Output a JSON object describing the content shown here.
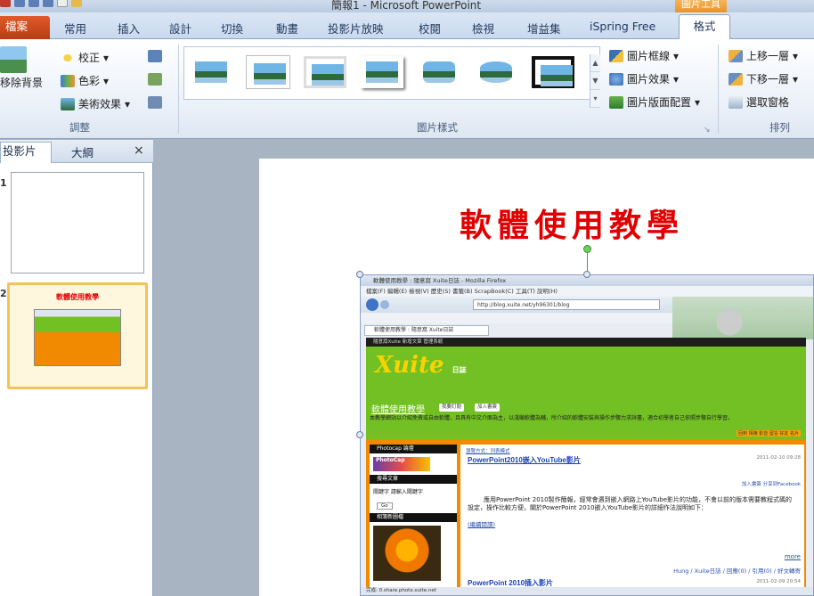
{
  "window": {
    "title": "簡報1 - Microsoft PowerPoint",
    "context_tab_group": "圖片工具"
  },
  "tabs": [
    {
      "label": "檔案"
    },
    {
      "label": "常用"
    },
    {
      "label": "插入"
    },
    {
      "label": "設計"
    },
    {
      "label": "切換"
    },
    {
      "label": "動畫"
    },
    {
      "label": "投影片放映"
    },
    {
      "label": "校閱"
    },
    {
      "label": "檢視"
    },
    {
      "label": "增益集"
    },
    {
      "label": "iSpring Free"
    },
    {
      "label": "格式"
    }
  ],
  "ribbon": {
    "adjust": {
      "remove_bg": "移除背景",
      "corrections": "校正",
      "color": "色彩",
      "artistic": "美術效果",
      "group_label": "調整"
    },
    "styles": {
      "border": "圖片框線",
      "effects": "圖片效果",
      "layout": "圖片版面配置",
      "group_label": "圖片樣式"
    },
    "arrange": {
      "bring_forward": "上移一層",
      "send_backward": "下移一層",
      "selection_pane": "選取窗格",
      "group_label": "排列"
    }
  },
  "slides_pane": {
    "tab_slides": "投影片",
    "tab_outline": "大綱",
    "close": "×",
    "slide1_num": "1",
    "slide2_num": "2",
    "slide2_thumb_title": "軟體使用教學"
  },
  "slide": {
    "title": "軟體使用教學"
  },
  "embedded_browser": {
    "window_title": "軟體使用教學 : 隨意窩 Xuite日誌 - Mozilla Firefox",
    "menu": "檔案(F)  編輯(E)  檢視(V)  歷史(S)  書籤(B)  ScrapBook(C)  工具(T)  說明(H)",
    "url": "http://blog.xuite.net/yh96301/blog",
    "tab": "軟體使用教學 : 隨意窩 Xuite日誌",
    "xuite_bar": "隨意窩Xuite  新增文章  管理系統",
    "logo": "Xuite",
    "logo_sub": "日誌",
    "blog_title": "軟體使用教學",
    "btn_subscribe": "我要訂閱",
    "btn_bookmark": "加入書簽",
    "description": "本教學網站以介紹免費或自由軟體，且具有中文介面為主，以淺顯軟體為輔，所介紹的軟體安裝與操作步驟力求詳盡，適合初學者自己依照步驟自行學習。",
    "nav_links": "回到  相簿  影音  留言  好友  名片",
    "side_photocap": "Photocap 論壇",
    "side_search": "搜尋文章",
    "side_search_hint": "關鍵字  請輸入關鍵字",
    "side_go": "Go",
    "side_photos": "相簿新圖檔",
    "crumb": "瀏覽方式：列表模式",
    "post_title": "PowerPoint2010嵌入YouTube影片",
    "post_date": "2011-02-10 09:28",
    "post_share": "加入書簽  分享到Facebook",
    "post_text": "應用PowerPoint 2010製作簡報，經常會遇到嵌入網路上YouTube影片的功能，不會以前的版本需要教程式碼的設定，操作比較方便，關於PowerPoint 2010嵌入YouTube影片的詳細作法說明如下：",
    "post_link": "(繼續閱讀)",
    "post_more": "more",
    "post_meta": "Hung / Xuite日誌 / 回應(0) / 引用(0) / 好文轉寄",
    "post2_title": "PowerPoint 2010插入影片",
    "post2_date": "2011-02-09 20:54",
    "status": "完成: 0.share.photo.xuite.net"
  }
}
